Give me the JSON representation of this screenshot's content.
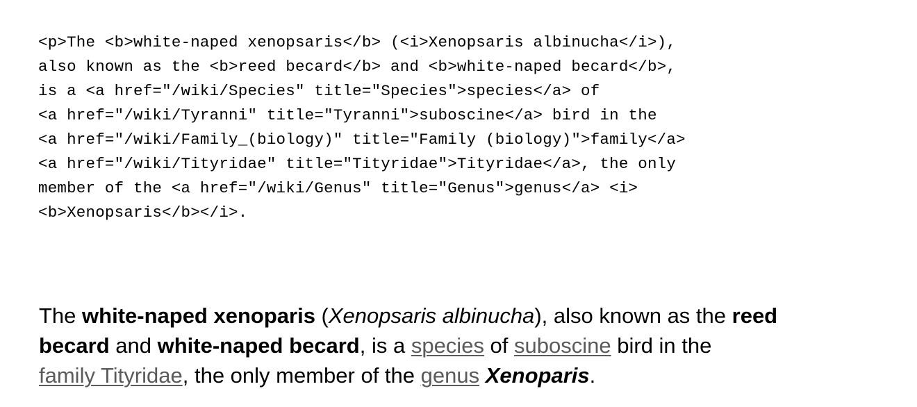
{
  "source": {
    "label": "html-source-markup",
    "lines": [
      "<p>The <b>white-naped xenopsaris</b> (<i>Xenopsaris albinucha</i>),",
      "also known as the <b>reed becard</b> and <b>white-naped becard</b>,",
      "is a <a href=\"/wiki/Species\" title=\"Species\">species</a> of",
      "<a href=\"/wiki/Tyranni\" title=\"Tyranni\">suboscine</a> bird in the",
      "<a href=\"/wiki/Family_(biology)\" title=\"Family (biology)\">family</a>",
      "<a href=\"/wiki/Tityridae\" title=\"Tityridae\">Tityridae</a>, the only",
      "member of the <a href=\"/wiki/Genus\" title=\"Genus\">genus</a> <i>",
      "<b>Xenopsaris</b></i>."
    ]
  },
  "rendered": {
    "label": "rendered-paragraph-output",
    "segments": [
      {
        "text": "The ",
        "style": "plain"
      },
      {
        "text": "white-naped xenoparis",
        "style": "bold"
      },
      {
        "text": " (",
        "style": "plain"
      },
      {
        "text": "Xenopsaris albinucha",
        "style": "italic"
      },
      {
        "text": "), also known as the ",
        "style": "plain"
      },
      {
        "text": "reed becard",
        "style": "bold"
      },
      {
        "text": " and ",
        "style": "plain"
      },
      {
        "text": "white-naped becard",
        "style": "bold"
      },
      {
        "text": ", is a ",
        "style": "plain"
      },
      {
        "text": "species",
        "style": "link"
      },
      {
        "text": " of ",
        "style": "plain"
      },
      {
        "text": "suboscine",
        "style": "link"
      },
      {
        "text": " bird in the ",
        "style": "plain"
      },
      {
        "text": "family Tityridae",
        "style": "link"
      },
      {
        "text": ", the only member of the ",
        "style": "plain"
      },
      {
        "text": "genus",
        "style": "link"
      },
      {
        "text": " ",
        "style": "plain"
      },
      {
        "text": "Xenoparis",
        "style": "bold-italic"
      },
      {
        "text": ".",
        "style": "plain"
      }
    ],
    "link_color": "#5a5a5a"
  },
  "page": {
    "background_color": "#ffffff",
    "text_color": "#000000"
  }
}
